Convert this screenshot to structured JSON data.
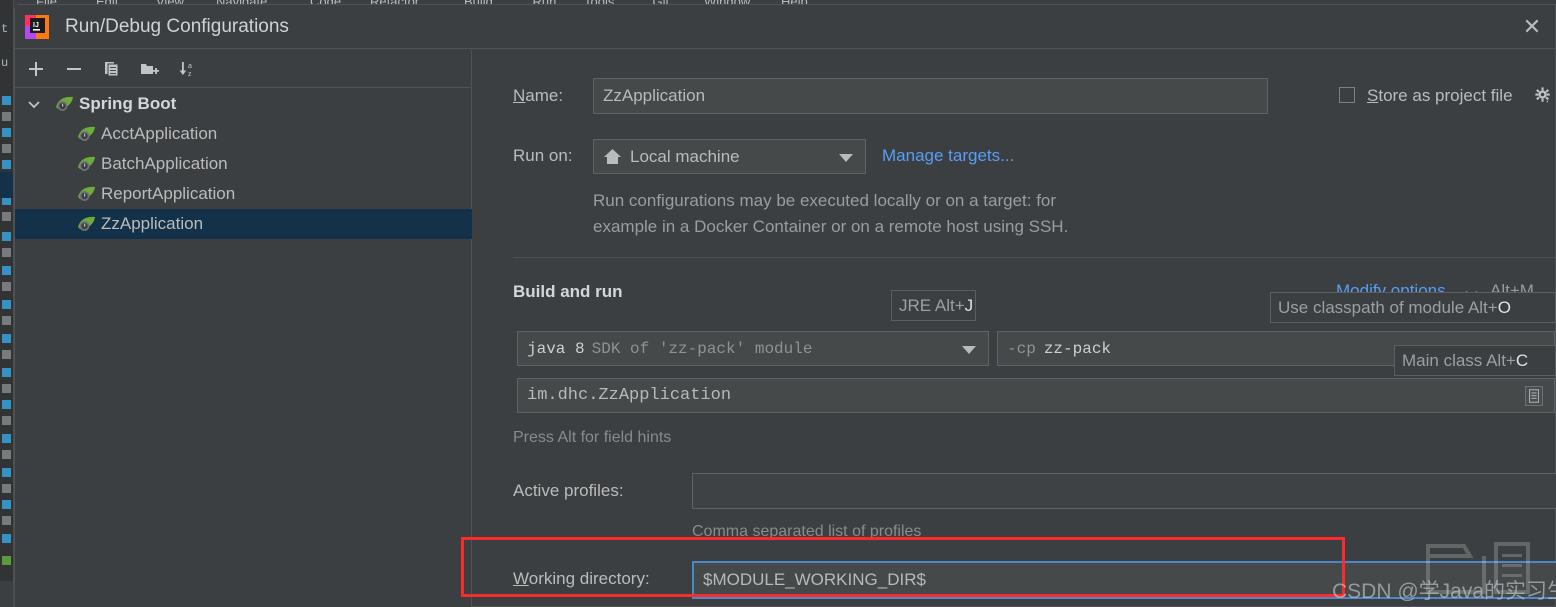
{
  "window": {
    "title": "Run/Debug Configurations",
    "close_label": "✕",
    "logo_name": "intellij-idea-logo"
  },
  "background_ide": {
    "menu_items": [
      "File",
      "Edit",
      "View",
      "Navigate",
      "Code",
      "Refactor",
      "Build",
      "Run",
      "Tools",
      "Git",
      "Window",
      "Help"
    ]
  },
  "left_panel": {
    "toolbar": [
      {
        "name": "add-configuration-button",
        "glyph": "+"
      },
      {
        "name": "remove-configuration-button",
        "glyph": "−"
      },
      {
        "name": "copy-configuration-button",
        "glyph": "copy-icon"
      },
      {
        "name": "new-folder-button",
        "glyph": "folder-add-icon"
      },
      {
        "name": "sort-configurations-button",
        "glyph": "sort-az-icon"
      }
    ],
    "tree": [
      {
        "label": "Spring Boot",
        "type": "group",
        "expanded": true,
        "selected": false,
        "icon": "spring-boot-icon"
      },
      {
        "label": "AcctApplication",
        "type": "item",
        "selected": false,
        "icon": "spring-boot-icon"
      },
      {
        "label": "BatchApplication",
        "type": "item",
        "selected": false,
        "icon": "spring-boot-icon"
      },
      {
        "label": "ReportApplication",
        "type": "item",
        "selected": false,
        "icon": "spring-boot-icon"
      },
      {
        "label": "ZzApplication",
        "type": "item",
        "selected": true,
        "icon": "spring-boot-icon"
      }
    ]
  },
  "form": {
    "name_label": "Name:",
    "name_value": "ZzApplication",
    "store_as_project_file_label": "Store as project file",
    "store_as_project_file_checked": false,
    "run_on_label": "Run on:",
    "run_on_value": "Local machine",
    "run_on_icon": "home-icon",
    "manage_targets_link": "Manage targets...",
    "run_on_description_line1": "Run configurations may be executed locally or on a target: for",
    "run_on_description_line2": "example in a Docker Container or on a remote host using SSH.",
    "build_and_run_title": "Build and run",
    "modify_options_link": "Modify options",
    "modify_options_shortcut": "Alt+M",
    "jre_value_bold": "java 8",
    "jre_value_rest": "SDK of 'zz-pack' module",
    "classpath_value_prefix": "-cp",
    "classpath_value": "zz-pack",
    "main_class_value": "im.dhc.ZzApplication",
    "press_alt_hint": "Press Alt for field hints",
    "active_profiles_label": "Active profiles:",
    "active_profiles_value": "",
    "active_profiles_hint": "Comma separated list of profiles",
    "working_directory_label": "Working directory:",
    "working_directory_value": "$MODULE_WORKING_DIR$"
  },
  "tooltips": [
    {
      "name": "jre-field-hint",
      "text": "JRE Alt+",
      "key": "J"
    },
    {
      "name": "classpath-module-field-hint",
      "text": "Use classpath of module Alt+",
      "key": "O"
    },
    {
      "name": "main-class-field-hint",
      "text": "Main class Alt+",
      "key": "C"
    }
  ],
  "annotation": {
    "type": "red-highlight-box"
  },
  "watermark": {
    "text": "CSDN @学Java的实习生"
  },
  "colors": {
    "dialog_bg": "#3c3f41",
    "field_bg": "#45494a",
    "selection": "#133149",
    "link": "#589df6",
    "focus_border": "#4a88c7",
    "annotation_red": "#fc2b2b",
    "spring_green": "#6cac3a"
  }
}
